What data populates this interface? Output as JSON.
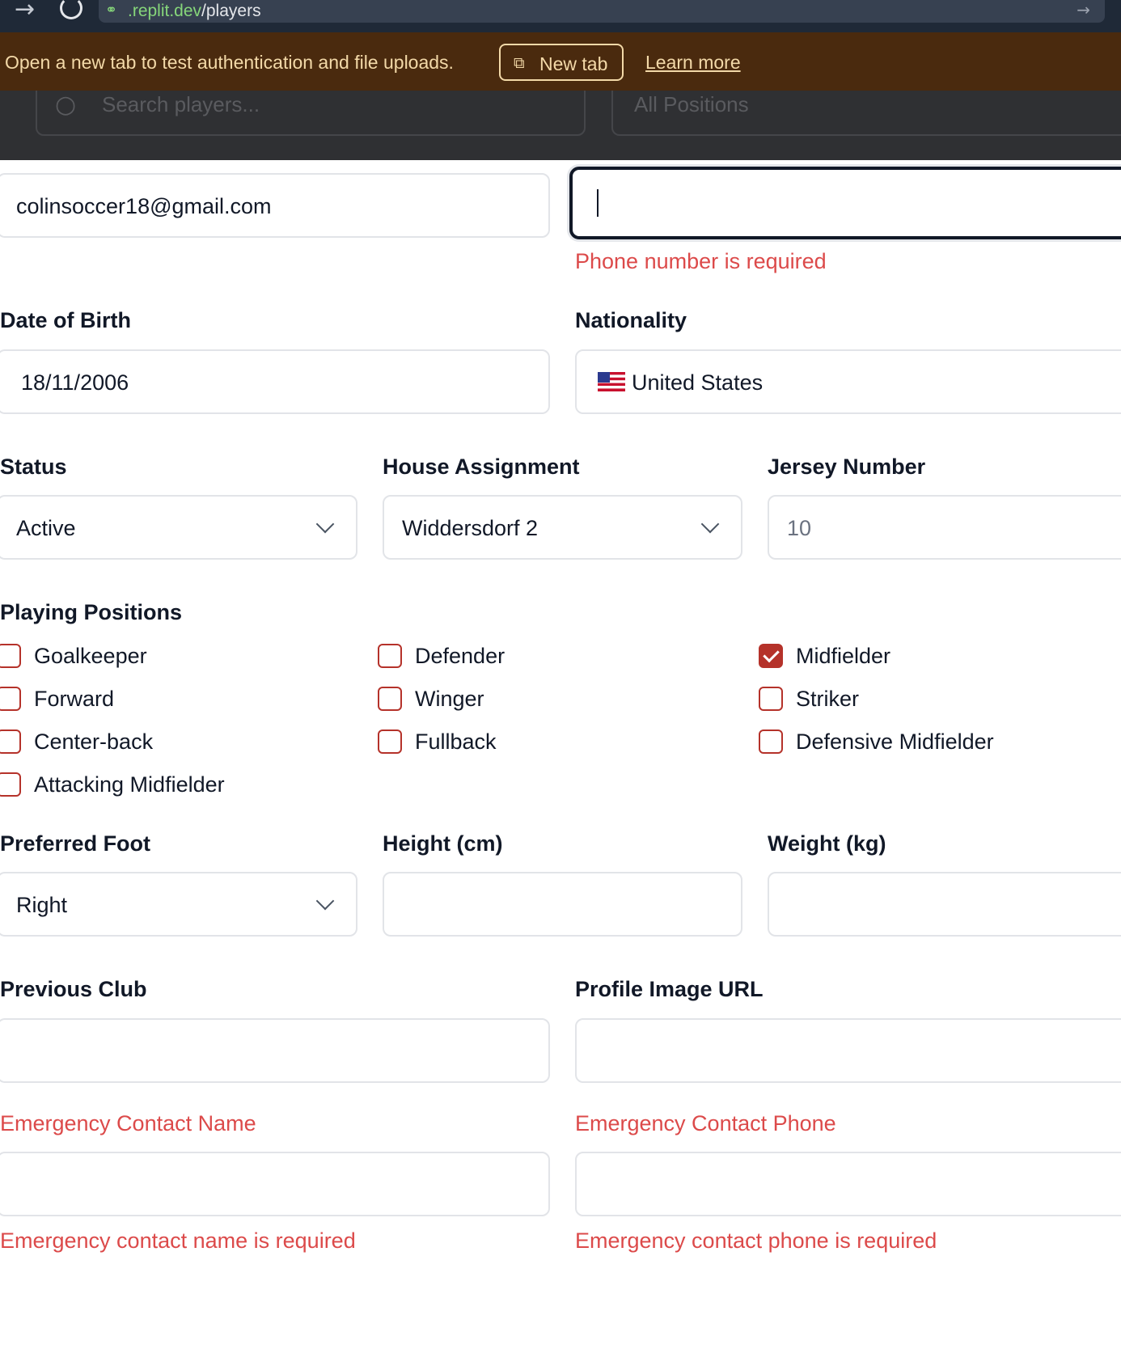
{
  "browser": {
    "url_domain": ".replit.dev",
    "url_path": "/players"
  },
  "banner": {
    "message": "Open a new tab to test authentication and file uploads.",
    "new_tab_label": "New tab",
    "learn_more_label": "Learn more"
  },
  "background": {
    "search_placeholder": "Search players...",
    "positions_filter": "All Positions"
  },
  "form": {
    "email": {
      "value": "colinsoccer18@gmail.com"
    },
    "phone": {
      "value": "",
      "error": "Phone number is required"
    },
    "date_of_birth": {
      "label": "Date of Birth",
      "value": "18/11/2006"
    },
    "nationality": {
      "label": "Nationality",
      "value": "United States",
      "flag_icon": "us-flag-icon"
    },
    "status": {
      "label": "Status",
      "value": "Active"
    },
    "house_assignment": {
      "label": "House Assignment",
      "value": "Widdersdorf 2"
    },
    "jersey_number": {
      "label": "Jersey Number",
      "placeholder": "10"
    },
    "playing_positions": {
      "label": "Playing Positions",
      "options": [
        {
          "label": "Goalkeeper",
          "checked": false
        },
        {
          "label": "Defender",
          "checked": false
        },
        {
          "label": "Midfielder",
          "checked": true
        },
        {
          "label": "Forward",
          "checked": false
        },
        {
          "label": "Winger",
          "checked": false
        },
        {
          "label": "Striker",
          "checked": false
        },
        {
          "label": "Center-back",
          "checked": false
        },
        {
          "label": "Fullback",
          "checked": false
        },
        {
          "label": "Defensive Midfielder",
          "checked": false
        },
        {
          "label": "Attacking Midfielder",
          "checked": false
        }
      ]
    },
    "preferred_foot": {
      "label": "Preferred Foot",
      "value": "Right"
    },
    "height": {
      "label": "Height (cm)",
      "value": ""
    },
    "weight": {
      "label": "Weight (kg)",
      "value": ""
    },
    "previous_club": {
      "label": "Previous Club",
      "value": ""
    },
    "profile_image_url": {
      "label": "Profile Image URL",
      "value": ""
    },
    "emergency_contact_name": {
      "label": "Emergency Contact Name",
      "value": "",
      "error": "Emergency contact name is required"
    },
    "emergency_contact_phone": {
      "label": "Emergency Contact Phone",
      "value": "",
      "error": "Emergency contact phone is required"
    }
  },
  "colors": {
    "error": "#dc4a4a",
    "checkbox_accent": "#b5322a",
    "banner_bg": "#4a2a0e",
    "banner_text": "#f3d9a8"
  }
}
